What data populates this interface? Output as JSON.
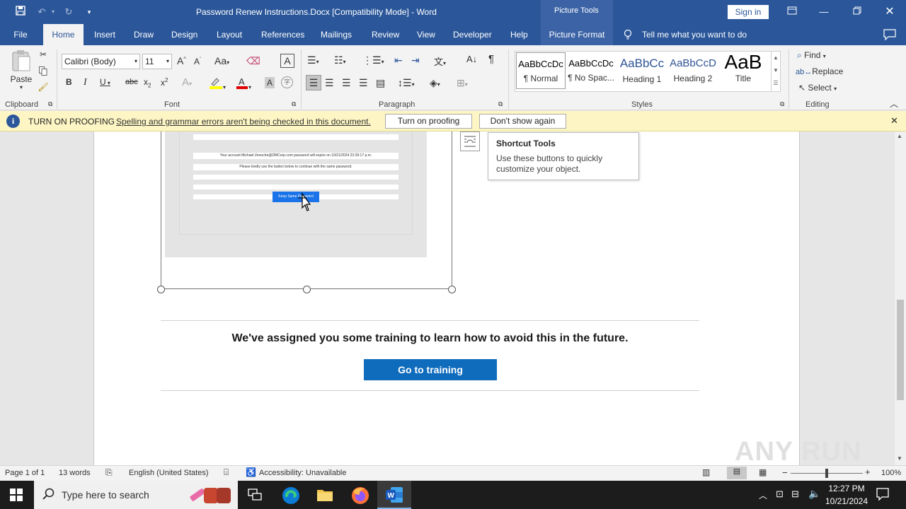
{
  "titlebar": {
    "title": "Password Renew Instructions.Docx [Compatibility Mode]  -  Word",
    "context_tab": "Picture Tools",
    "signin": "Sign in"
  },
  "tabs": [
    "File",
    "Home",
    "Insert",
    "Draw",
    "Design",
    "Layout",
    "References",
    "Mailings",
    "Review",
    "View",
    "Developer",
    "Help",
    "Picture Format"
  ],
  "tellme": "Tell me what you want to do",
  "ribbon": {
    "clipboard": {
      "paste": "Paste",
      "label": "Clipboard"
    },
    "font": {
      "name": "Calibri (Body)",
      "size": "11",
      "label": "Font"
    },
    "paragraph": {
      "label": "Paragraph"
    },
    "styles": {
      "label": "Styles",
      "items": [
        {
          "preview": "AaBbCcDc",
          "name": "¶ Normal"
        },
        {
          "preview": "AaBbCcDc",
          "name": "¶ No Spac..."
        },
        {
          "preview": "AaBbCc",
          "name": "Heading 1"
        },
        {
          "preview": "AaBbCcD",
          "name": "Heading 2"
        },
        {
          "preview": "AaB",
          "name": "Title"
        }
      ]
    },
    "editing": {
      "find": "Find",
      "replace": "Replace",
      "select": "Select",
      "label": "Editing"
    }
  },
  "infobar": {
    "title": "TURN ON PROOFING",
    "message": "Spelling and grammar errors aren't being checked in this document.",
    "btn_on": "Turn on proofing",
    "btn_dont": "Don't show again"
  },
  "document": {
    "image_line1": "Your account Michael.Venoche@DMCorp.com password will expire on 10/21/2024 23:39:17 p.m.",
    "image_line2": "Please kindly use the button below to continue with the same password.",
    "image_button": "Keep Same Password",
    "tooltip_title": "Shortcut Tools",
    "tooltip_text": "Use these buttons to quickly customize your object.",
    "training_heading": "We've assigned you some training to learn how to avoid this in the future.",
    "training_button": "Go to training",
    "watermark": "ANY RUN"
  },
  "status": {
    "page": "Page 1 of 1",
    "words": "13 words",
    "language": "English (United States)",
    "accessibility": "Accessibility: Unavailable",
    "zoom": "100%"
  },
  "taskbar": {
    "search_placeholder": "Type here to search",
    "time": "12:27 PM",
    "date": "10/21/2024"
  },
  "colors": {
    "word_blue": "#2b579a",
    "training_button": "#0f6cbd",
    "infobar": "#fdf6c4"
  }
}
